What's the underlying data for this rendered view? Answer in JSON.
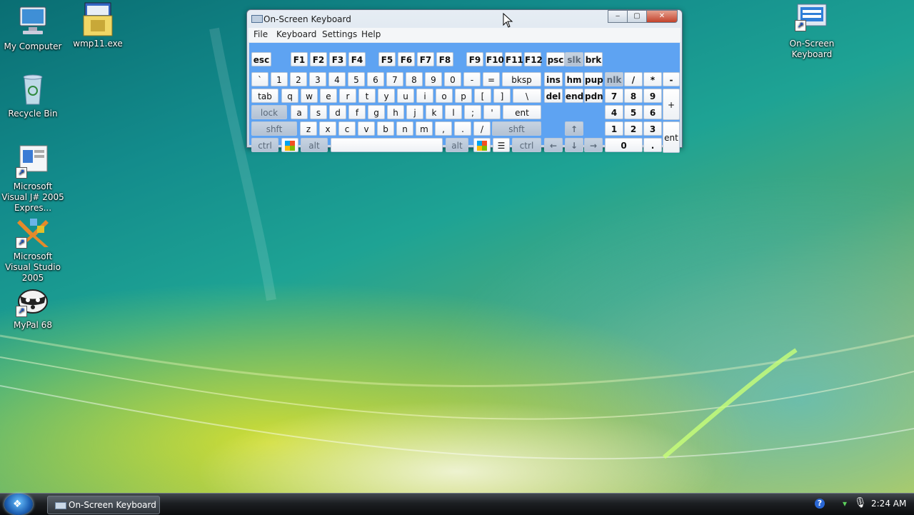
{
  "desktop": {
    "icons": [
      {
        "label": "My Computer",
        "icon": "computer-icon"
      },
      {
        "label": "wmp11.exe",
        "icon": "installer-icon"
      },
      {
        "label": "Recycle Bin",
        "icon": "recycle-bin-icon"
      },
      {
        "label": "Microsoft Visual J# 2005 Expres...",
        "icon": "vjsharp-icon"
      },
      {
        "label": "Microsoft Visual Studio 2005",
        "icon": "visual-studio-icon"
      },
      {
        "label": "MyPal 68",
        "icon": "mypal-icon"
      },
      {
        "label": "On-Screen Keyboard",
        "icon": "keyboard-icon"
      }
    ]
  },
  "window": {
    "title": "On-Screen Keyboard",
    "controls": {
      "minimize": "‒",
      "maximize": "▢",
      "close": "✕"
    },
    "menu": [
      "File",
      "Keyboard",
      "Settings",
      "Help"
    ]
  },
  "keyboard": {
    "row_fn": [
      "esc",
      "F1",
      "F2",
      "F3",
      "F4",
      "F5",
      "F6",
      "F7",
      "F8",
      "F9",
      "F10",
      "F11",
      "F12",
      "psc",
      "slk",
      "brk"
    ],
    "row_num": [
      "`",
      "1",
      "2",
      "3",
      "4",
      "5",
      "6",
      "7",
      "8",
      "9",
      "0",
      "-",
      "=",
      "bksp",
      "ins",
      "hm",
      "pup",
      "nlk",
      "/",
      "*",
      "-"
    ],
    "row_q": [
      "tab",
      "q",
      "w",
      "e",
      "r",
      "t",
      "y",
      "u",
      "i",
      "o",
      "p",
      "[",
      "]",
      "\\",
      "del",
      "end",
      "pdn",
      "7",
      "8",
      "9",
      "+"
    ],
    "row_a": [
      "lock",
      "a",
      "s",
      "d",
      "f",
      "g",
      "h",
      "j",
      "k",
      "l",
      ";",
      "'",
      "ent",
      "4",
      "5",
      "6"
    ],
    "row_z": [
      "shft",
      "z",
      "x",
      "c",
      "v",
      "b",
      "n",
      "m",
      ",",
      ".",
      "/",
      "shft",
      "↑",
      "1",
      "2",
      "3",
      "ent"
    ],
    "row_space": [
      "ctrl",
      "win",
      "alt",
      "",
      "alt",
      "win",
      "menu",
      "ctrl",
      "←",
      "↓",
      "→",
      "0",
      "."
    ]
  },
  "taskbar": {
    "task_label": "On-Screen Keyboard",
    "clock": "2:24 AM",
    "help": "?"
  }
}
